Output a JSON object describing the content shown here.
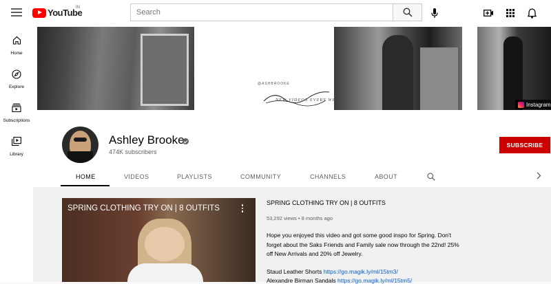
{
  "header": {
    "logo_text": "YouTube",
    "country_code": "IN",
    "search_placeholder": "Search"
  },
  "sidebar": {
    "items": [
      {
        "label": "Home",
        "icon": "home-icon"
      },
      {
        "label": "Explore",
        "icon": "compass-icon"
      },
      {
        "label": "Subscriptions",
        "icon": "subscriptions-icon"
      },
      {
        "label": "Library",
        "icon": "library-icon"
      }
    ]
  },
  "banner": {
    "handle": "@ASHBROOKE",
    "tagline": "NEW VIDEOS EVERY WEEK",
    "instagram_label": "Instagram"
  },
  "channel": {
    "name": "Ashley Brooke",
    "subscribers": "474K subscribers",
    "subscribe_label": "SUBSCRIBE"
  },
  "tabs": [
    {
      "label": "HOME",
      "active": true
    },
    {
      "label": "VIDEOS"
    },
    {
      "label": "PLAYLISTS"
    },
    {
      "label": "COMMUNITY"
    },
    {
      "label": "CHANNELS"
    },
    {
      "label": "ABOUT"
    }
  ],
  "featured": {
    "thumb_title": "SPRING CLOTHING TRY ON | 8 OUTFITS",
    "title": "SPRING CLOTHING TRY ON | 8 OUTFITS",
    "views": "53,292 views",
    "age": "8 months ago",
    "meta": "53,292 views • 8 months ago",
    "description": "Hope you enjoyed this video and got some good inspo for Spring. Don't forget about the Saks Friends and Family sale now through the 22nd! 25% off New Arrivals and 20% off Jewelry.",
    "links": [
      {
        "label": "Staud Leather Shorts",
        "url": "https://go.magik.ly/ml/15tm3/"
      },
      {
        "label": "Alexandre Birman Sandals",
        "url": "https://go.magik.ly/ml/15tm5/"
      }
    ]
  },
  "colors": {
    "brand_red": "#ff0000",
    "subscribe_red": "#cc0000",
    "link_blue": "#065fd4"
  }
}
